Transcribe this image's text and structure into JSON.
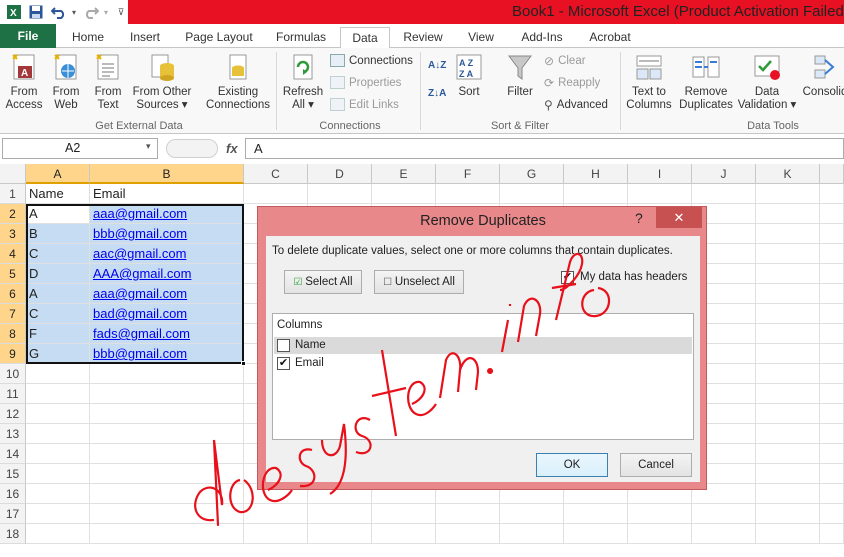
{
  "window": {
    "title": "Book1  -  Microsoft Excel (Product Activation Failed)"
  },
  "qat": {
    "save_icon": "save-icon",
    "undo_icon": "undo-icon",
    "redo_icon": "redo-icon",
    "customize_icon": "customize-icon"
  },
  "tabs": [
    {
      "label": "File"
    },
    {
      "label": "Home"
    },
    {
      "label": "Insert"
    },
    {
      "label": "Page Layout"
    },
    {
      "label": "Formulas"
    },
    {
      "label": "Data"
    },
    {
      "label": "Review"
    },
    {
      "label": "View"
    },
    {
      "label": "Add-Ins"
    },
    {
      "label": "Acrobat"
    }
  ],
  "ribbon": {
    "get_external": {
      "group": "Get External Data",
      "from_access": [
        "From",
        "Access"
      ],
      "from_web": [
        "From",
        "Web"
      ],
      "from_text": [
        "From",
        "Text"
      ],
      "from_other": [
        "From Other",
        "Sources ▾"
      ],
      "existing": [
        "Existing",
        "Connections"
      ]
    },
    "connections": {
      "group": "Connections",
      "refresh": [
        "Refresh",
        "All ▾"
      ],
      "connections": "Connections",
      "properties": "Properties",
      "edit_links": "Edit Links"
    },
    "sort_filter": {
      "group": "Sort & Filter",
      "az": "A↓Z",
      "za": "Z↓A",
      "sort": "Sort",
      "filter": "Filter",
      "clear": "Clear",
      "reapply": "Reapply",
      "advanced": "Advanced"
    },
    "data_tools": {
      "group": "Data Tools",
      "text_to_columns": [
        "Text to",
        "Columns"
      ],
      "remove_dup": [
        "Remove",
        "Duplicates"
      ],
      "validation": [
        "Data",
        "Validation ▾"
      ],
      "consolidate": "Consolid"
    }
  },
  "formula_bar": {
    "name_box": "A2",
    "fx": "fx",
    "value": "A"
  },
  "grid": {
    "columns": [
      "A",
      "B",
      "C",
      "D",
      "E",
      "F",
      "G",
      "H",
      "I",
      "J",
      "K"
    ],
    "rows": [
      "1",
      "2",
      "3",
      "4",
      "5",
      "6",
      "7",
      "8",
      "9",
      "10",
      "11",
      "12",
      "13",
      "14",
      "15",
      "16",
      "17",
      "18"
    ],
    "data": [
      [
        "Name",
        "Email"
      ],
      [
        "A",
        "aaa@gmail.com"
      ],
      [
        "B",
        "bbb@gmail.com"
      ],
      [
        "C",
        "aac@gmail.com"
      ],
      [
        "D",
        "AAA@gmail.com"
      ],
      [
        "A",
        "aaa@gmail.com"
      ],
      [
        "C",
        "bad@gmail.com"
      ],
      [
        "F",
        "fads@gmail.com"
      ],
      [
        "G",
        "bbb@gmail.com"
      ]
    ]
  },
  "dialog": {
    "title": "Remove Duplicates",
    "help": "?",
    "close": "✕",
    "instruction": "To delete duplicate values, select one or more columns that contain duplicates.",
    "select_all": "Select All",
    "unselect_all": "Unselect All",
    "headers_label": "My data has headers",
    "headers_checked": true,
    "columns_header": "Columns",
    "columns": [
      {
        "label": "Name",
        "checked": false
      },
      {
        "label": "Email",
        "checked": true
      }
    ],
    "ok": "OK",
    "cancel": "Cancel"
  },
  "watermark": {
    "text": "doesystem.info",
    "color": "#e8101a"
  }
}
